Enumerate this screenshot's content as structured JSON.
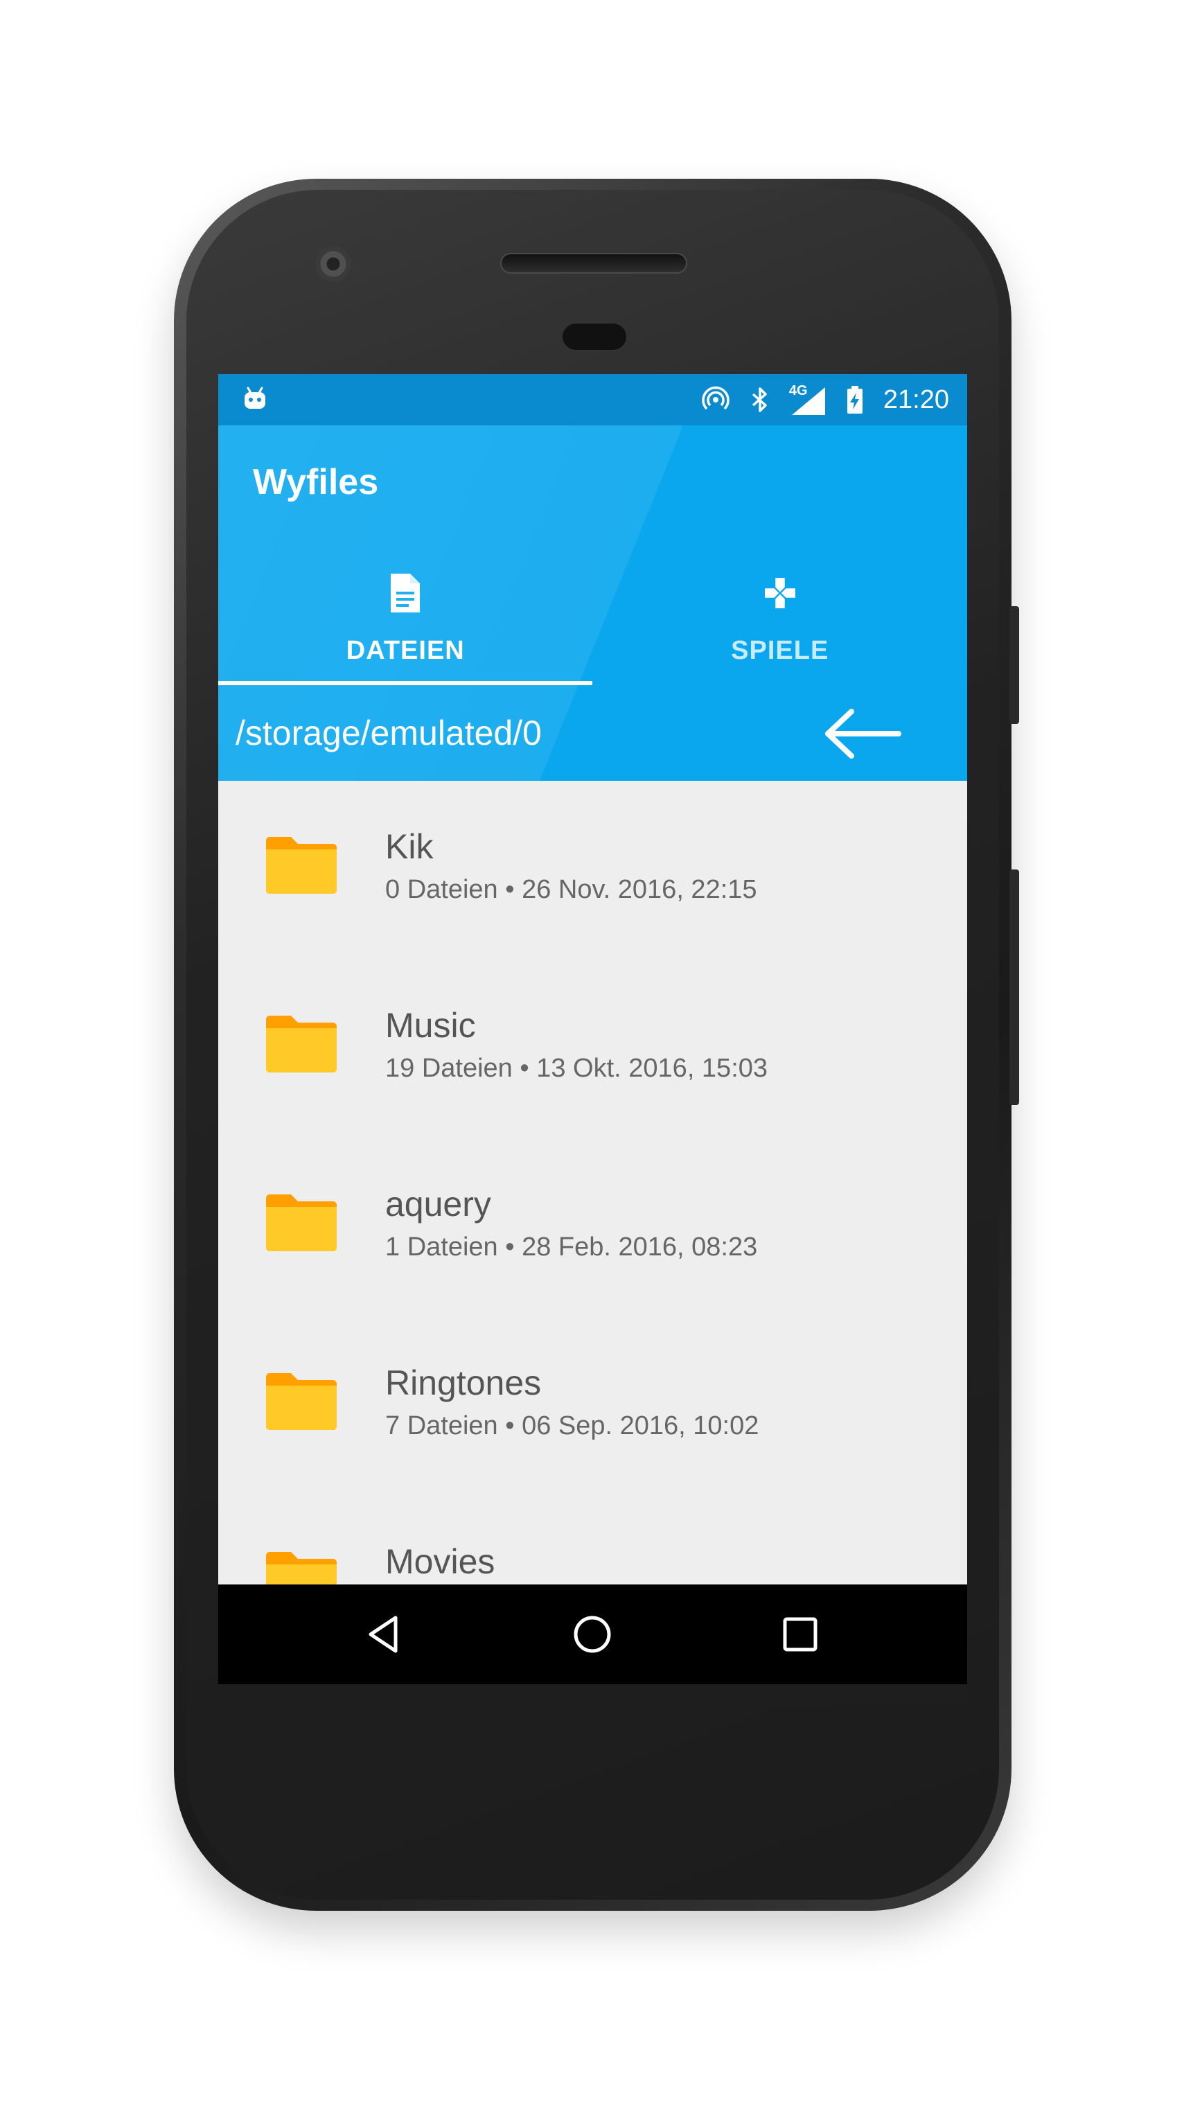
{
  "status_bar": {
    "time": "21:20",
    "network": "4G",
    "icons": [
      "android-icon",
      "hotspot-icon",
      "bluetooth-icon",
      "signal-icon",
      "battery-charging-icon"
    ]
  },
  "app": {
    "title": "Wyfiles"
  },
  "tabs": [
    {
      "label": "DATEIEN",
      "icon": "document-icon",
      "active": true
    },
    {
      "label": "SPIELE",
      "icon": "gamepad-icon",
      "active": false
    }
  ],
  "path": {
    "current": "/storage/emulated/0",
    "back_icon": "arrow-left-icon"
  },
  "files": [
    {
      "name": "Kik",
      "meta": "0 Dateien • 26 Nov. 2016, 22:15",
      "icon": "folder-icon"
    },
    {
      "name": "Music",
      "meta": "19 Dateien • 13 Okt. 2016, 15:03",
      "icon": "folder-icon"
    },
    {
      "name": "aquery",
      "meta": "1 Dateien • 28 Feb. 2016, 08:23",
      "icon": "folder-icon"
    },
    {
      "name": "Ringtones",
      "meta": "7 Dateien • 06 Sep. 2016, 10:02",
      "icon": "folder-icon"
    },
    {
      "name": "Movies",
      "meta": "",
      "icon": "folder-icon"
    }
  ],
  "nav": {
    "icons": [
      "nav-back-icon",
      "nav-home-icon",
      "nav-recent-icon"
    ]
  },
  "colors": {
    "status_bar": "#0a8bd0",
    "primary": "#0aa7ef",
    "list_background": "#eeeeee",
    "folder": "#ffca28",
    "navbar": "#000000"
  }
}
